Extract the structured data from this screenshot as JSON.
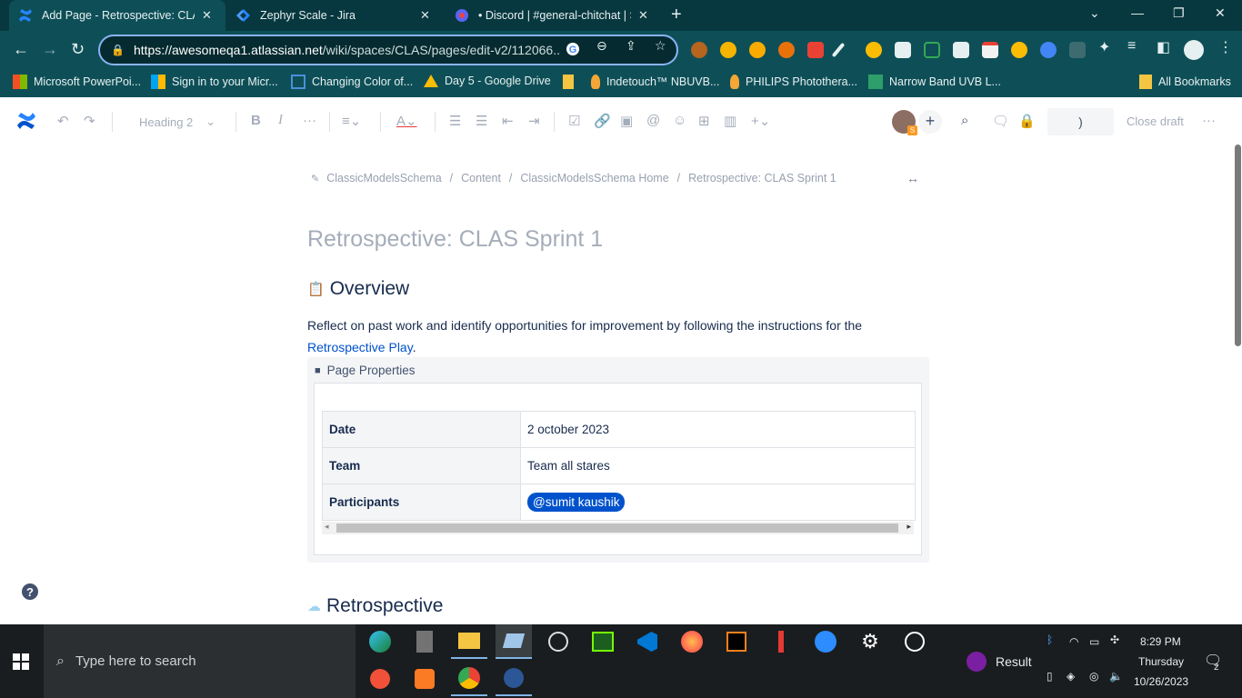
{
  "browser": {
    "tabs": [
      {
        "title": "Add Page - Retrospective: CLAS",
        "active": true
      },
      {
        "title": "Zephyr Scale - Jira",
        "active": false
      },
      {
        "title": "• Discord | #general-chitchat | SI",
        "active": false
      }
    ],
    "url_host": "https://awesomeqa1.atlassian.net",
    "url_path": "/wiki/spaces/CLAS/pages/edit-v2/112066..."
  },
  "bookmarks": [
    {
      "label": "Microsoft PowerPoi...",
      "color": "#f25022"
    },
    {
      "label": "Sign in to your Micr...",
      "color": "#7fba00"
    },
    {
      "label": "Changing Color of...",
      "color": "#4a90d9"
    },
    {
      "label": "Day 5 - Google Drive",
      "color": "#fbbc04"
    },
    {
      "label": "",
      "color": "#f4c542"
    },
    {
      "label": "Indetouch™ NBUVB...",
      "color": "#f4a636"
    },
    {
      "label": "PHILIPS Photothera...",
      "color": "#f4a636"
    },
    {
      "label": "Narrow Band UVB L...",
      "color": "#2e9e6a"
    }
  ],
  "bookmarks_all": "All Bookmarks",
  "editor": {
    "heading_select": "Heading 2",
    "close_draft": "Close draft",
    "publish_placeholder": ")"
  },
  "page": {
    "breadcrumb": [
      "ClassicModelsSchema",
      "Content",
      "ClassicModelsSchema Home",
      "Retrospective: CLAS Sprint 1"
    ],
    "title": "Retrospective: CLAS Sprint 1",
    "overview_heading": "Overview",
    "intro_text": "Reflect on past work and identify opportunities for improvement by following the instructions for the",
    "intro_link": "Retrospective Play",
    "intro_end": ".",
    "page_properties_label": "Page Properties",
    "properties": [
      {
        "key": "Date",
        "value": "2 october 2023"
      },
      {
        "key": "Team",
        "value": "Team all stares"
      },
      {
        "key": "Participants",
        "mention": "@sumit kaushik"
      }
    ],
    "retro_heading": "Retrospective"
  },
  "taskbar": {
    "search_placeholder": "Type here to search",
    "result_label": "Result",
    "time": "8:29 PM",
    "day": "Thursday",
    "date": "10/26/2023",
    "notification_count": "2"
  },
  "colors": {
    "chrome_dark": "#08383f",
    "chrome_toolbar": "#0e4f57",
    "confluence_blue": "#0052cc",
    "text_primary": "#172b4d"
  }
}
